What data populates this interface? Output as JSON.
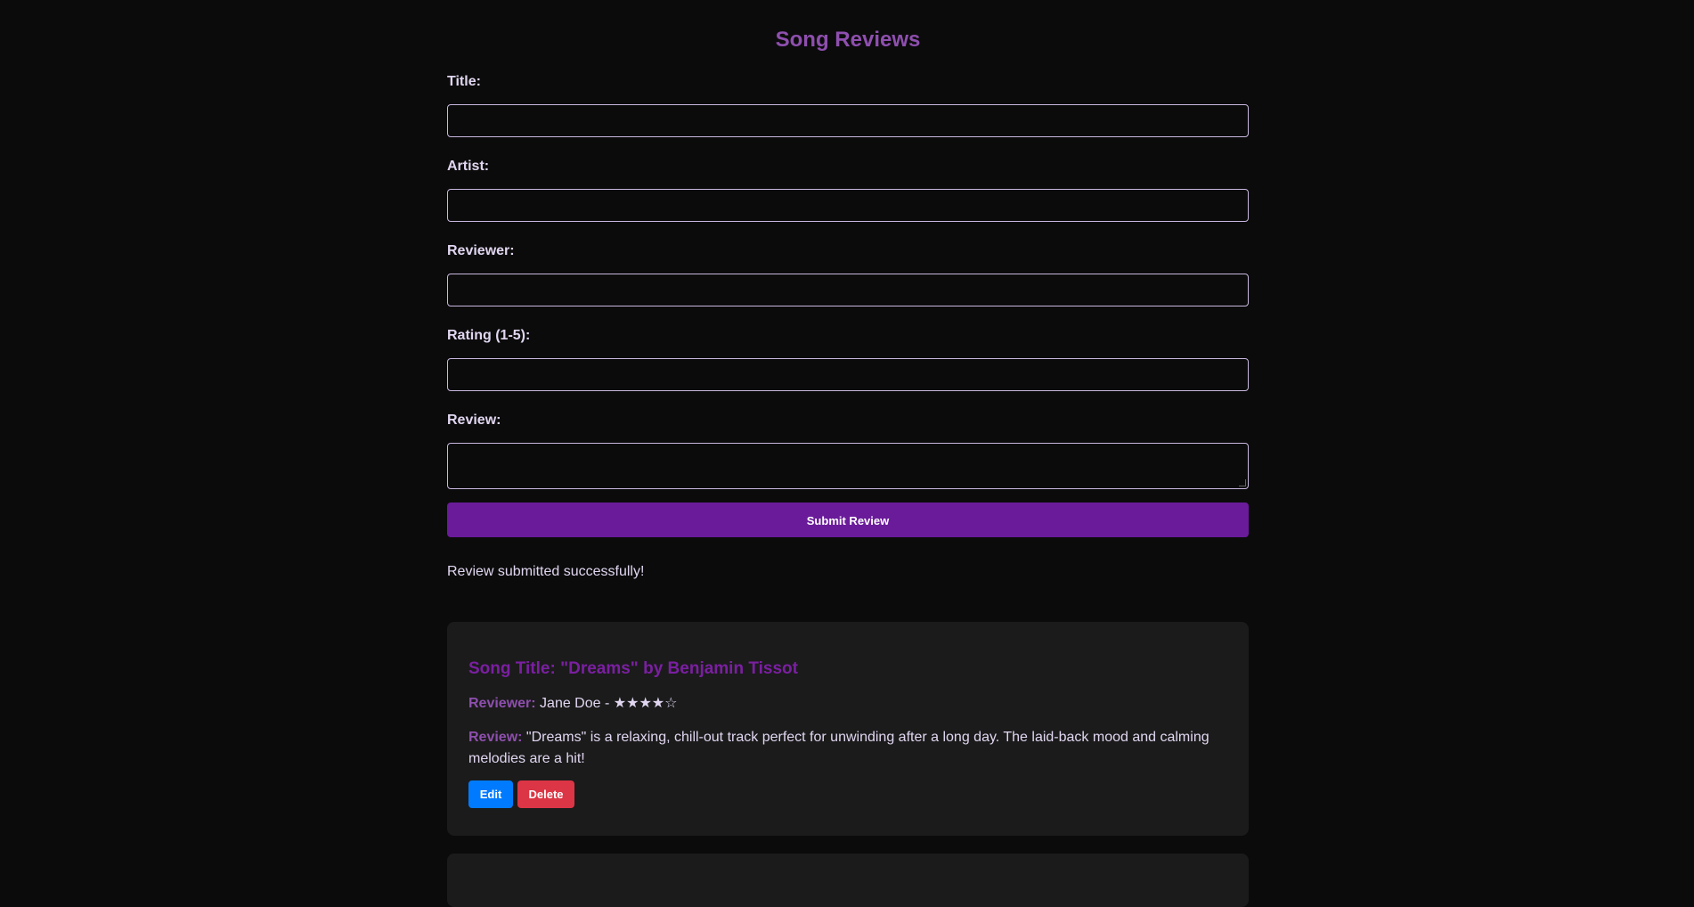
{
  "page": {
    "title": "Song Reviews"
  },
  "form": {
    "fields": [
      {
        "label": "Title:",
        "value": "",
        "placeholder": ""
      },
      {
        "label": "Artist:",
        "value": "",
        "placeholder": ""
      },
      {
        "label": "Reviewer:",
        "value": "",
        "placeholder": ""
      },
      {
        "label": "Rating (1-5):",
        "value": "",
        "placeholder": ""
      },
      {
        "label": "Review:",
        "value": "",
        "placeholder": ""
      }
    ],
    "submit_label": "Submit Review"
  },
  "status": {
    "message": "Review submitted successfully!"
  },
  "reviews": [
    {
      "song_title": "Song Title: \"Dreams\" by Benjamin Tissot",
      "reviewer_key": "Reviewer:",
      "reviewer_value": " Jane Doe - ★★★★☆",
      "review_key": "Review:",
      "review_text": " \"Dreams\" is a relaxing, chill-out track perfect for unwinding after a long day. The laid-back mood and calming melodies are a hit!",
      "edit_label": "Edit",
      "delete_label": "Delete"
    }
  ],
  "colors": {
    "background": "#0b0b0b",
    "accent_purple": "#8e4fae",
    "button_purple": "#6a1b9a",
    "card_background": "#1b1b1b",
    "edit_blue": "#007bff",
    "delete_red": "#dc3545"
  }
}
